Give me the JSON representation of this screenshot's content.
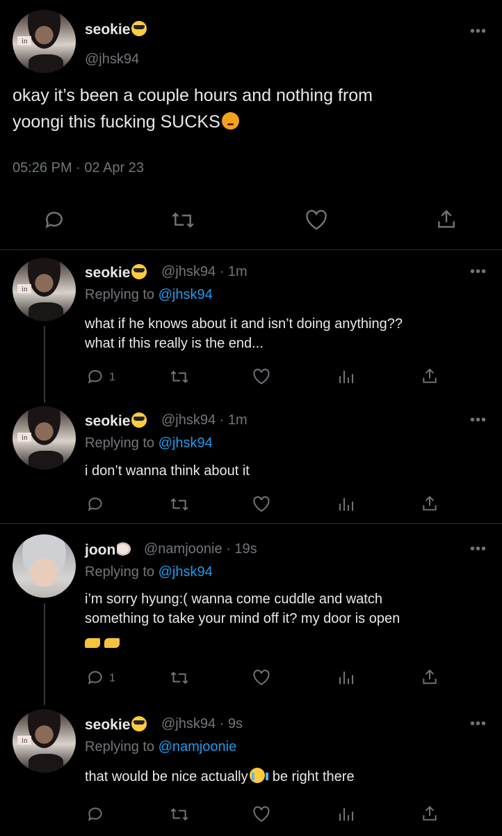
{
  "main_tweet": {
    "display_name": "seokie",
    "name_emoji": "smiling-face-with-sunglasses",
    "handle": "@jhsk94",
    "text": "okay it’s been a couple hours and nothing from yoongi this fucking SUCKS",
    "text_line1": "okay it’s been a couple hours and nothing from",
    "text_line2": "yoongi this fucking SUCKS",
    "text_emoji": "pouting-face",
    "timestamp": "05:26 PM · 02 Apr 23"
  },
  "replies": [
    {
      "display_name": "seokie",
      "handle": "@jhsk94 · 1m",
      "replying_prefix": "Replying to",
      "replying_to": "@jhsk94",
      "line1": "what if he knows about it and isn’t doing anything??",
      "line2": "what if this really is the end...",
      "reply_count": "1"
    },
    {
      "display_name": "seokie",
      "handle": "@jhsk94 · 1m",
      "replying_prefix": "Replying to",
      "replying_to": "@jhsk94",
      "line1": "i don’t wanna think about it"
    },
    {
      "display_name": "joon",
      "name_emoji": "spiral-shell",
      "handle": "@namjoonie · 19s",
      "replying_prefix": "Replying to",
      "replying_to": "@jhsk94",
      "line1": "i’m sorry hyung:( wanna come cuddle and watch",
      "line2": "something to take your mind off it? my door is open",
      "line3_emoji": "pointing-hands",
      "reply_count": "1"
    },
    {
      "display_name": "seokie",
      "handle": "@jhsk94 · 9s",
      "replying_prefix": "Replying to",
      "replying_to": "@namjoonie",
      "text_before": "that would be nice actually",
      "text_emoji": "loudly-crying-face",
      "text_after": "be right there"
    }
  ],
  "avatar_sign_text": "in",
  "more_label": "•••",
  "colors": {
    "background": "#000000",
    "text": "#e7e9ea",
    "muted": "#71767b",
    "link": "#1d9bf0",
    "divider": "#2f3336"
  }
}
